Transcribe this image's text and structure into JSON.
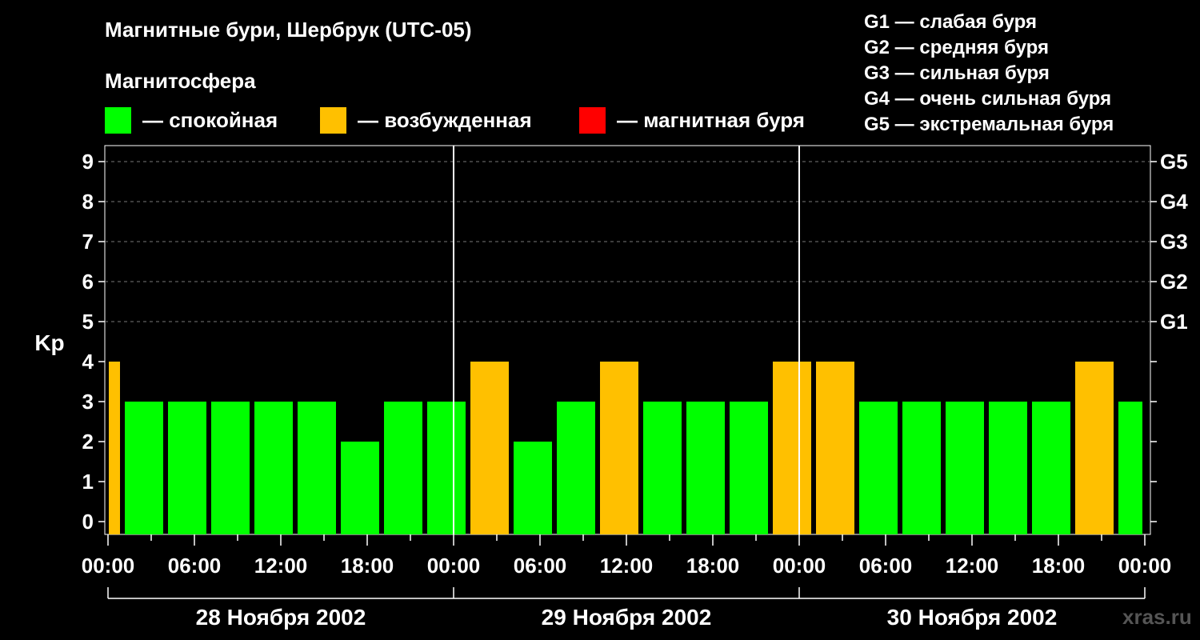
{
  "header": {
    "title": "Магнитные бури, Шербрук (UTC-05)",
    "subtitle": "Магнитосфера"
  },
  "legend": [
    {
      "label": "— спокойная",
      "color": "#00ff00"
    },
    {
      "label": "— возбужденная",
      "color": "#ffc000"
    },
    {
      "label": "— магнитная буря",
      "color": "#ff0000"
    }
  ],
  "storm_scale": [
    "G1 — слабая буря",
    "G2 — средняя буря",
    "G3 — сильная буря",
    "G4 — очень сильная буря",
    "G5 — экстремальная буря"
  ],
  "brand": "xras.ru",
  "chart_data": {
    "type": "bar",
    "ylabel": "Kp",
    "ylim": [
      0,
      9
    ],
    "yticks": [
      "0",
      "1",
      "2",
      "3",
      "4",
      "5",
      "6",
      "7",
      "8",
      "9"
    ],
    "right_labels": [
      {
        "level": 5,
        "label": "G1"
      },
      {
        "level": 6,
        "label": "G2"
      },
      {
        "level": 7,
        "label": "G3"
      },
      {
        "level": 8,
        "label": "G4"
      },
      {
        "level": 9,
        "label": "G5"
      }
    ],
    "xticks": [
      "00:00",
      "06:00",
      "12:00",
      "18:00",
      "00:00",
      "06:00",
      "12:00",
      "18:00",
      "00:00",
      "06:00",
      "12:00",
      "18:00",
      "00:00"
    ],
    "days": [
      "28 Ноября 2002",
      "29 Ноября 2002",
      "30 Ноября 2002"
    ],
    "grid": true,
    "series": [
      {
        "values": [
          4,
          3,
          3,
          3,
          3,
          3,
          2,
          3,
          3,
          4,
          2,
          3,
          4,
          3,
          3,
          3,
          4,
          4,
          3,
          3,
          3,
          3,
          3,
          4,
          3
        ],
        "colors": [
          "#ffc000",
          "#00ff00",
          "#00ff00",
          "#00ff00",
          "#00ff00",
          "#00ff00",
          "#00ff00",
          "#00ff00",
          "#00ff00",
          "#ffc000",
          "#00ff00",
          "#00ff00",
          "#ffc000",
          "#00ff00",
          "#00ff00",
          "#00ff00",
          "#ffc000",
          "#ffc000",
          "#00ff00",
          "#00ff00",
          "#00ff00",
          "#00ff00",
          "#00ff00",
          "#ffc000",
          "#00ff00"
        ]
      }
    ]
  }
}
